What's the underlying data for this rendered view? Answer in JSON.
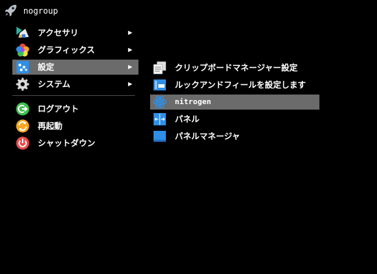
{
  "header": {
    "title": "nogroup",
    "icon": "rocket-icon"
  },
  "menu": {
    "items": [
      {
        "label": "アクセサリ",
        "icon": "accessories-icon",
        "has_submenu": true
      },
      {
        "label": "グラフィックス",
        "icon": "graphics-icon",
        "has_submenu": true
      },
      {
        "label": "設定",
        "icon": "settings-icon",
        "has_submenu": true,
        "selected": true
      },
      {
        "label": "システム",
        "icon": "system-gear-icon",
        "has_submenu": true
      },
      {
        "label": "ログアウト",
        "icon": "logout-icon",
        "has_submenu": false
      },
      {
        "label": "再起動",
        "icon": "reboot-icon",
        "has_submenu": false
      },
      {
        "label": "シャットダウン",
        "icon": "shutdown-icon",
        "has_submenu": false
      }
    ],
    "arrow": "▶"
  },
  "submenu": {
    "items": [
      {
        "label": "クリップボードマネージャー設定",
        "icon": "clipboard-icon"
      },
      {
        "label": "ルックアンドフィールを設定します",
        "icon": "appearance-icon"
      },
      {
        "label": "nitrogen",
        "icon": "nitrogen-icon",
        "selected": true
      },
      {
        "label": "パネル",
        "icon": "panel-icon"
      },
      {
        "label": "パネルマネージャ",
        "icon": "panel-manager-icon"
      }
    ]
  },
  "colors": {
    "background": "#000000",
    "selected": "#6b6b6b",
    "text": "#ffffff",
    "accent_blue": "#2f8fe6",
    "logout_green": "#3fbf4f",
    "reboot_orange": "#f5a623",
    "shutdown_red": "#e84a4a"
  }
}
